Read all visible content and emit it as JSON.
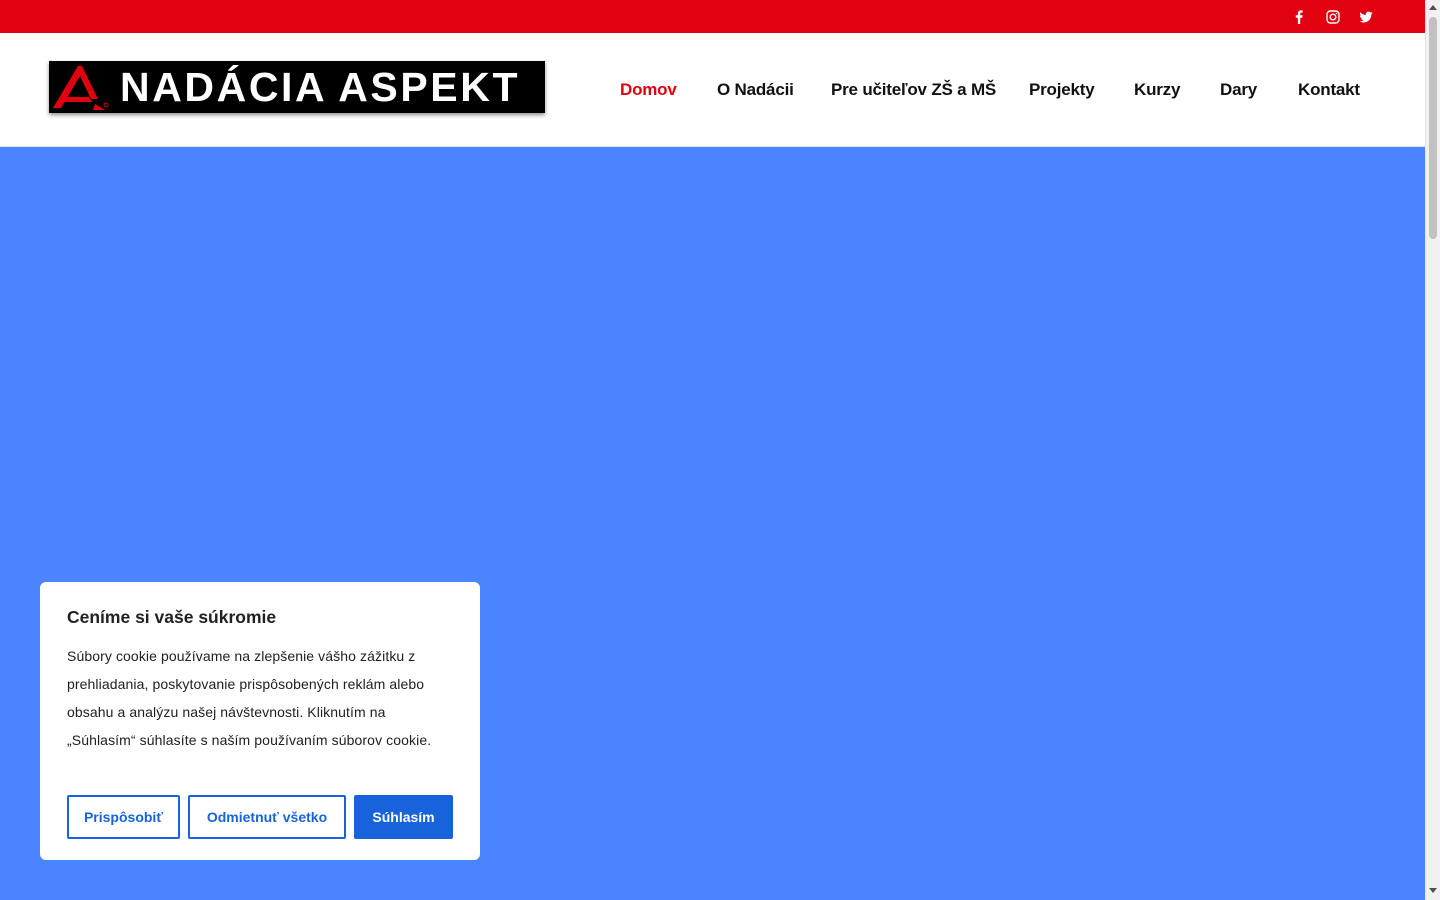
{
  "topbar": {
    "bg_color": "#e0000f",
    "social": [
      {
        "icon": "facebook-icon"
      },
      {
        "icon": "instagram-icon"
      },
      {
        "icon": "twitter-icon"
      }
    ]
  },
  "header": {
    "logo_text": "NADÁCIA ASPEKT",
    "nav": [
      {
        "label": "Domov",
        "active": true
      },
      {
        "label": "O Nadácii",
        "active": false
      },
      {
        "label": "Pre učiteľov ZŠ a MŠ",
        "active": false
      },
      {
        "label": "Projekty",
        "active": false
      },
      {
        "label": "Kurzy",
        "active": false
      },
      {
        "label": "Dary",
        "active": false
      },
      {
        "label": "Kontakt",
        "active": false
      }
    ],
    "active_color": "#e0000f"
  },
  "hero": {
    "bg_color": "#4a84ff"
  },
  "cookie_banner": {
    "title": "Ceníme si vaše súkromie",
    "text": "Súbory cookie používame na zlepšenie vášho zážitku z prehliadania, poskytovanie prispôsobených reklám alebo obsahu a analýzu našej návštevnosti. Kliknutím na „Súhlasím“ súhlasíte s naším používaním súborov cookie.",
    "buttons": {
      "customize": "Prispôsobiť",
      "reject": "Odmietnuť všetko",
      "accept": "Súhlasím"
    },
    "accent_color": "#1863dc"
  }
}
